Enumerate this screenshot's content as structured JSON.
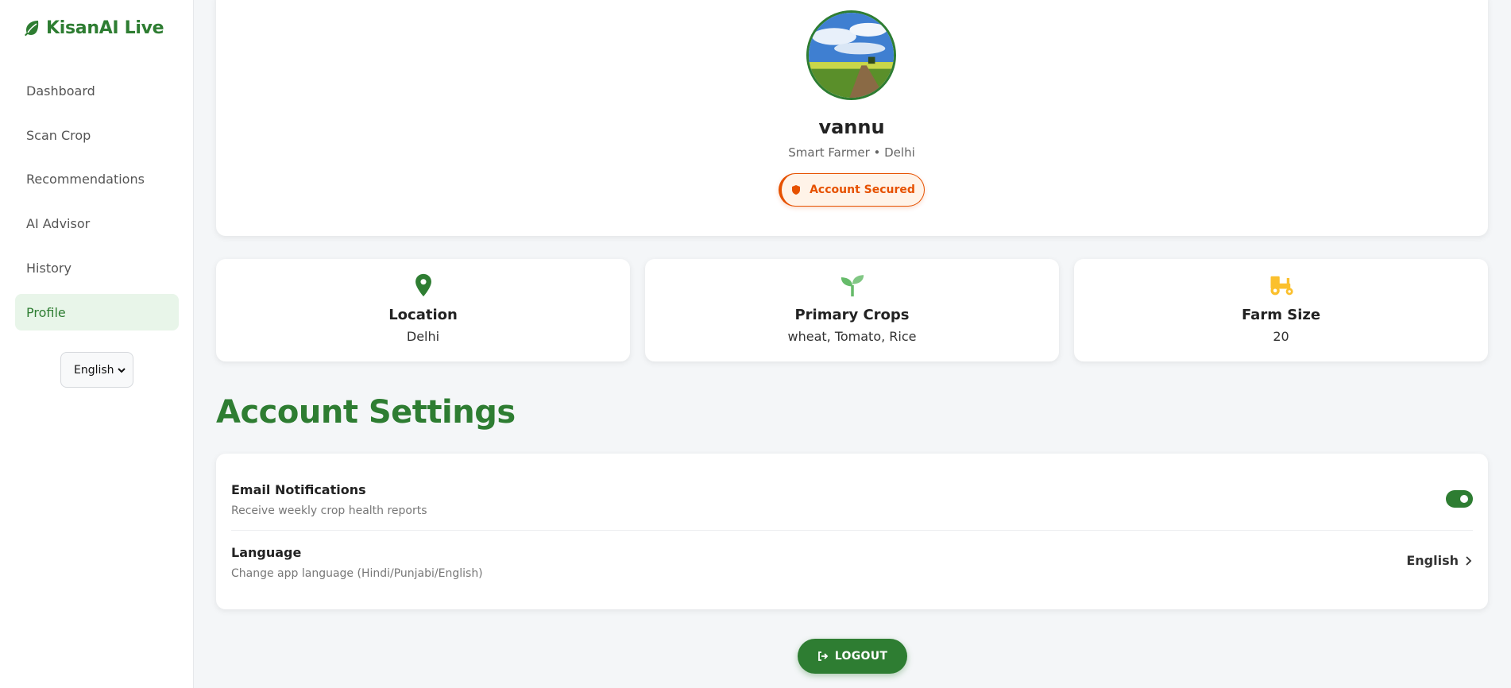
{
  "brand": {
    "name": "KisanAI Live",
    "icon": "leaf-icon"
  },
  "sidebar": {
    "items": [
      {
        "label": "Dashboard",
        "active": false
      },
      {
        "label": "Scan Crop",
        "active": false
      },
      {
        "label": "Recommendations",
        "active": false
      },
      {
        "label": "AI Advisor",
        "active": false
      },
      {
        "label": "History",
        "active": false
      },
      {
        "label": "Profile",
        "active": true
      }
    ],
    "language_select": {
      "value": "English"
    }
  },
  "profile": {
    "name": "vannu",
    "subtitle": "Smart Farmer • Delhi",
    "badge": "Account Secured"
  },
  "stats": [
    {
      "icon": "location-pin-icon",
      "title": "Location",
      "value": "Delhi",
      "color": "#2e7d32"
    },
    {
      "icon": "seedling-icon",
      "title": "Primary Crops",
      "value": "wheat, Tomato, Rice",
      "color": "#66bb6a"
    },
    {
      "icon": "tractor-icon",
      "title": "Farm Size",
      "value": "20",
      "color": "#fbc02d"
    }
  ],
  "settings": {
    "title": "Account Settings",
    "email": {
      "title": "Email Notifications",
      "description": "Receive weekly crop health reports",
      "enabled": true
    },
    "language": {
      "title": "Language",
      "description": "Change app language (Hindi/Punjabi/English)",
      "value": "English"
    }
  },
  "logout_label": "LOGOUT",
  "colors": {
    "primary": "#2e7d32",
    "accent": "#e65100",
    "background": "#f4f6f8"
  }
}
